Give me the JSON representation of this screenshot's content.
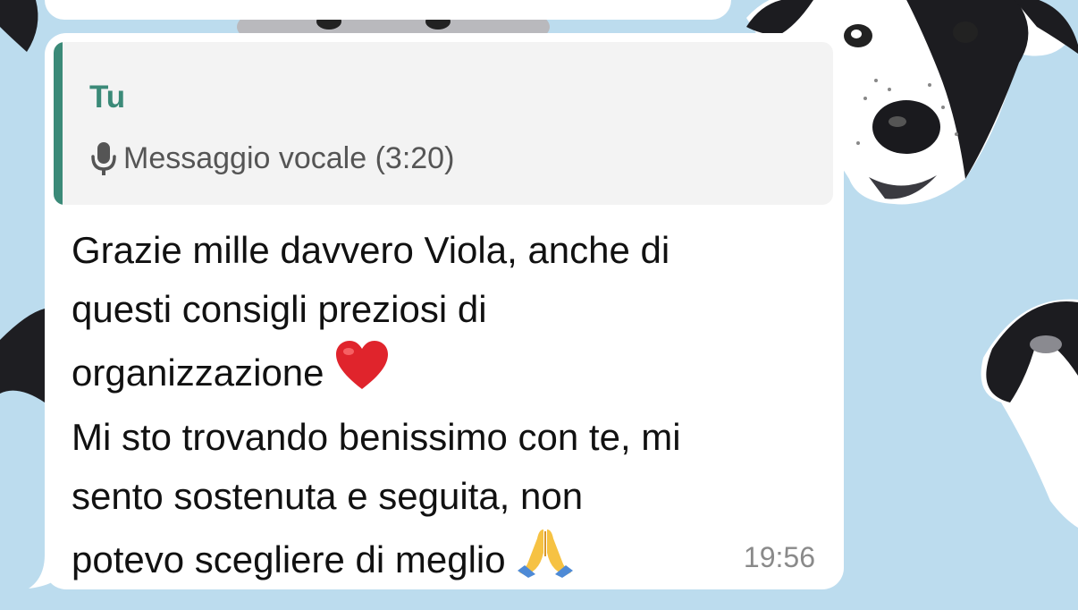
{
  "message": {
    "quote_author": "Tu",
    "quote_text": "Messaggio vocale (3:20)",
    "line1": "Grazie mille davvero Viola, anche di",
    "line2": "questi consigli preziosi di",
    "line3_text": "organizzazione ",
    "line4": "Mi sto trovando benissimo con te, mi",
    "line5": "sento sostenuta e seguita, non",
    "line6_text": "potevo scegliere di meglio ",
    "time": "19:56",
    "emoji_1": "red-heart",
    "emoji_2": "folded-hands"
  },
  "colors": {
    "background": "#bcdcee",
    "bubble": "#ffffff",
    "quote_accent": "#3b8a78",
    "quote_background": "#f3f3f3"
  }
}
